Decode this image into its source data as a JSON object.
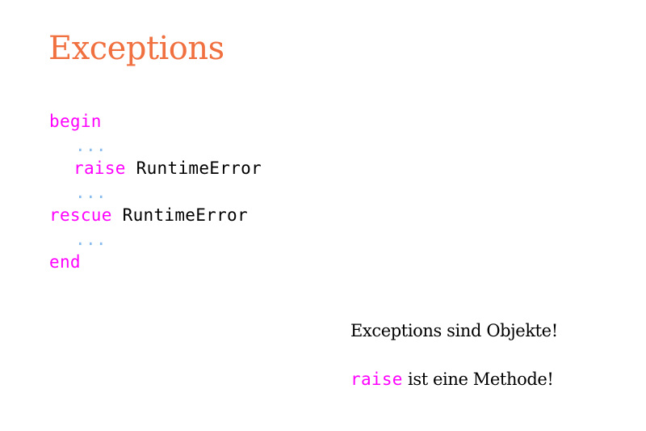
{
  "slide": {
    "title": "Exceptions"
  },
  "code": {
    "line1": {
      "keyword": "begin"
    },
    "line2": {
      "dots": "..."
    },
    "line3": {
      "keyword": "raise",
      "argument": "RuntimeError"
    },
    "line4": {
      "dots": "..."
    },
    "line5": {
      "keyword": "rescue",
      "argument": "RuntimeError"
    },
    "line6": {
      "dots": "..."
    },
    "line7": {
      "keyword": "end"
    }
  },
  "notes": {
    "note1": "Exceptions sind Objekte!",
    "note2_keyword": "raise",
    "note2_text": "ist eine Methode!"
  },
  "colors": {
    "title": "#f07040",
    "keyword": "#ff00ff",
    "dots": "#88bbee",
    "text": "#000000"
  }
}
